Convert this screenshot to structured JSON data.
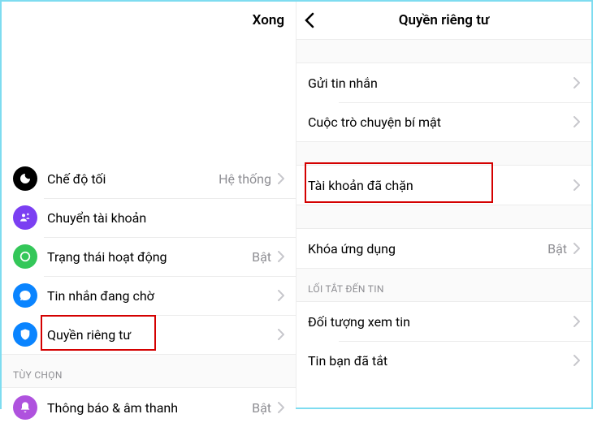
{
  "left": {
    "done": "Xong",
    "rows": {
      "darkmode": {
        "label": "Chế độ tối",
        "value": "Hệ thống"
      },
      "switch": {
        "label": "Chuyển tài khoản"
      },
      "active": {
        "label": "Trạng thái hoạt động",
        "value": "Bật"
      },
      "pending": {
        "label": "Tin nhắn đang chờ"
      },
      "privacy": {
        "label": "Quyền riêng tư"
      }
    },
    "section_options": "TÙY CHỌN",
    "notif": {
      "label": "Thông báo & âm thanh",
      "value": "Bật"
    }
  },
  "right": {
    "title": "Quyền riêng tư",
    "rows": {
      "send": {
        "label": "Gửi tin nhắn"
      },
      "secret": {
        "label": "Cuộc trò chuyện bí mật"
      },
      "blocked": {
        "label": "Tài khoản đã chặn"
      },
      "applock": {
        "label": "Khóa ứng dụng",
        "value": "Bật"
      }
    },
    "section_story": "LỐI TẮT ĐẾN TIN",
    "story_audience": {
      "label": "Đối tượng xem tin"
    },
    "story_muted": {
      "label": "Tin bạn đã tắt"
    }
  }
}
